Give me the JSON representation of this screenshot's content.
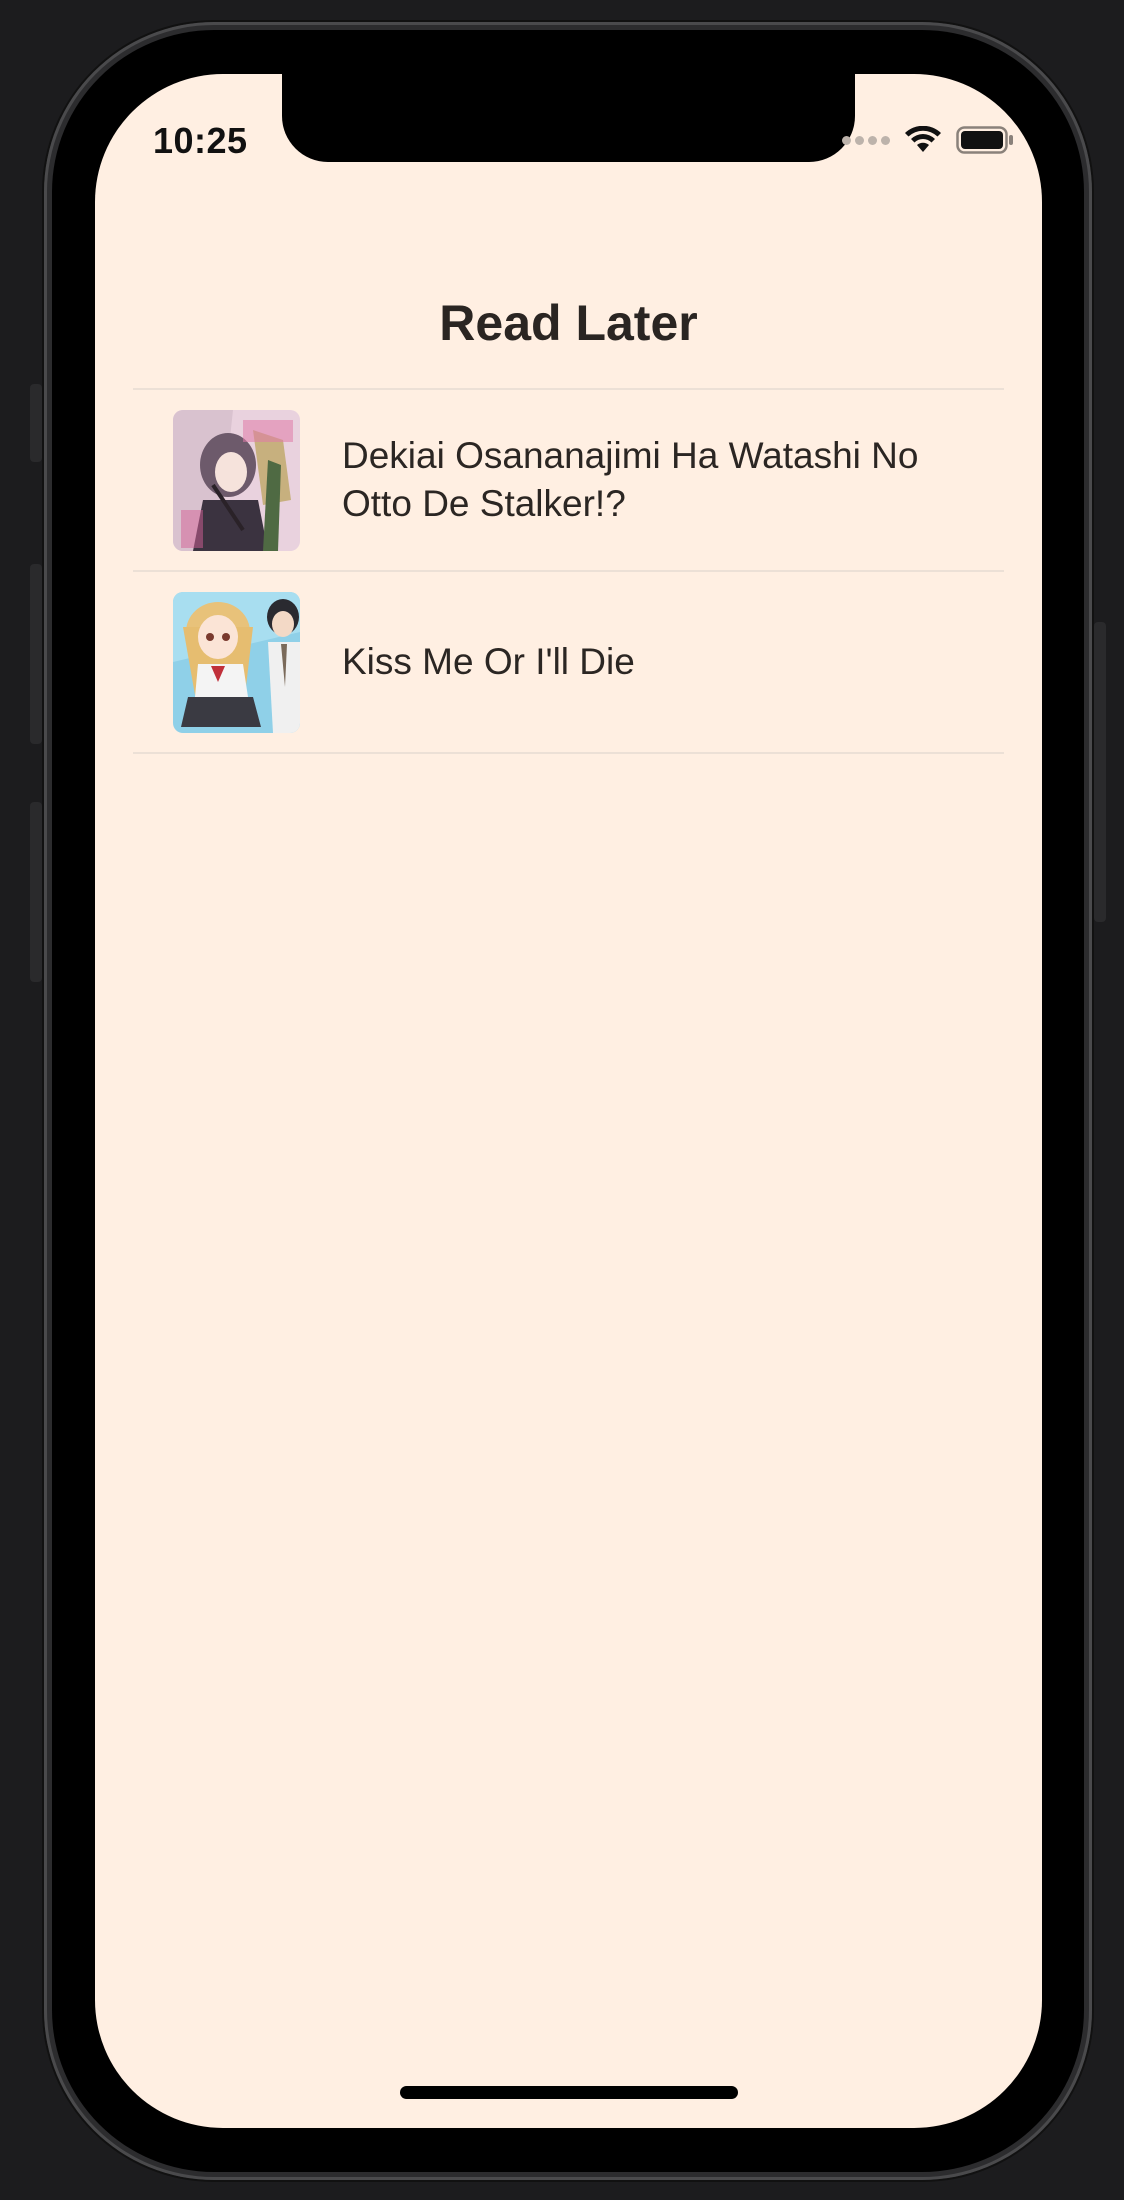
{
  "status_bar": {
    "time": "10:25",
    "icons": [
      "cellular-signal-icon",
      "wifi-icon",
      "battery-icon"
    ]
  },
  "nav": {
    "title": "Read Later"
  },
  "list": {
    "items": [
      {
        "title": "Dekiai Osananajimi Ha Watashi No Otto De Stalker!?",
        "cover": "manga-cover-icon"
      },
      {
        "title": "Kiss Me Or I'll Die",
        "cover": "manga-cover-icon"
      }
    ]
  },
  "colors": {
    "background": "#ffefe2",
    "text": "#2b2623",
    "separator": "#ece0d6"
  }
}
